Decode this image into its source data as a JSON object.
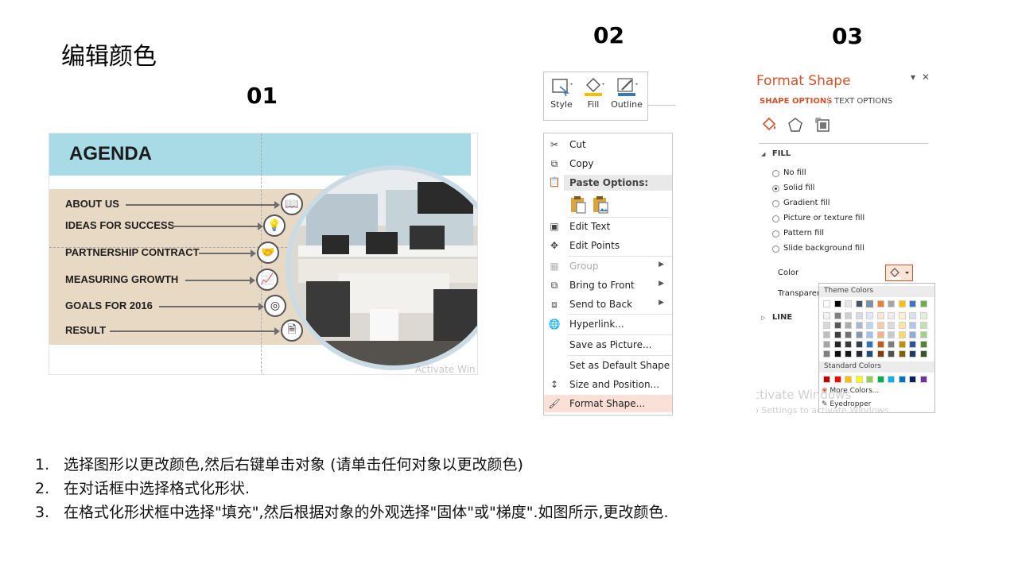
{
  "title": "编辑颜色",
  "steps_nums": {
    "s1": "01",
    "s2": "02",
    "s3": "03"
  },
  "agenda": {
    "heading": "AGENDA",
    "items": [
      "ABOUT US",
      "IDEAS FOR SUCCESS",
      "PARTNERSHIP CONTRACT",
      "MEASURING GROWTH",
      "GOALS FOR 2016",
      "RESULT"
    ],
    "icons": [
      "book-icon",
      "lightbulb-icon",
      "handshake-icon",
      "growth-chart-icon",
      "target-icon",
      "report-icon"
    ],
    "watermark": "Activate Win"
  },
  "minibar": {
    "style": "Style",
    "fill": "Fill",
    "outline": "Outline"
  },
  "context_menu": {
    "cut": "Cut",
    "copy": "Copy",
    "paste_options": "Paste Options:",
    "edit_text": "Edit Text",
    "edit_points": "Edit Points",
    "group": "Group",
    "bring_to_front": "Bring to Front",
    "send_to_back": "Send to Back",
    "hyperlink": "Hyperlink...",
    "save_as_picture": "Save as Picture...",
    "set_default_shape": "Set as Default Shape",
    "size_and_position": "Size and Position...",
    "format_shape": "Format Shape..."
  },
  "format_pane": {
    "title": "Format Shape",
    "tab_shape": "SHAPE OPTIONS",
    "tab_text": "TEXT OPTIONS",
    "fill_section": "FILL",
    "fill_options": [
      "No fill",
      "Solid fill",
      "Gradient fill",
      "Picture or texture fill",
      "Pattern fill",
      "Slide background fill"
    ],
    "selected_fill": "Solid fill",
    "color_label": "Color",
    "transparency_label": "Transparen",
    "line_section": "LINE",
    "theme_colors": "Theme Colors",
    "standard_colors": "Standard Colors",
    "more_colors": "More Colors...",
    "eyedropper": "Eyedropper",
    "watermark1": "ctivate Windows",
    "watermark2": "o Settings to activate Windows.",
    "accent": "#d1542c"
  },
  "instructions": [
    {
      "num": "1.",
      "text": "选择图形以更改颜色,然后右键单击对象 (请单击任何对象以更改颜色)"
    },
    {
      "num": "2.",
      "text": "在对话框中选择格式化形状."
    },
    {
      "num": "3.",
      "text": "在格式化形状框中选择\"填充\",然后根据对象的外观选择\"固体\"或\"梯度\".如图所示,更改颜色."
    }
  ]
}
